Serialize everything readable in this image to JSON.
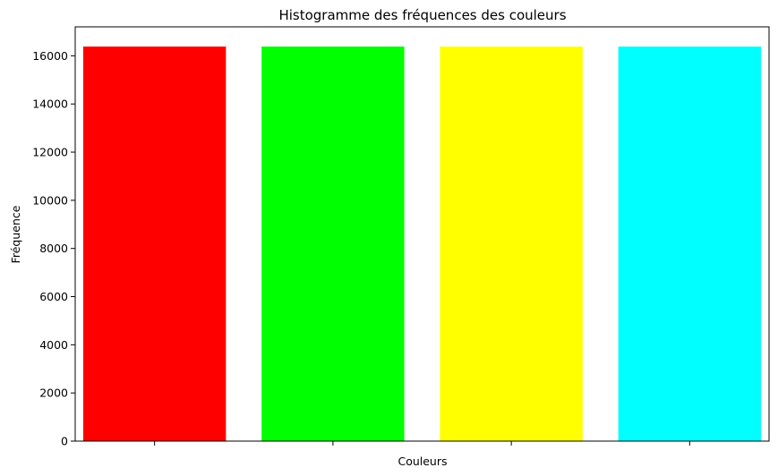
{
  "chart_data": {
    "type": "bar",
    "title": "Histogramme des fréquences des couleurs",
    "xlabel": "Couleurs",
    "ylabel": "Fréquence",
    "categories": [
      "",
      "",
      "",
      ""
    ],
    "values": [
      16384,
      16384,
      16384,
      16384
    ],
    "colors": [
      "#ff0000",
      "#00ff00",
      "#ffff00",
      "#00ffff"
    ],
    "ylim": [
      0,
      17203
    ],
    "yticks": [
      0,
      2000,
      4000,
      6000,
      8000,
      10000,
      12000,
      14000,
      16000
    ],
    "grid": false,
    "legend": false
  }
}
